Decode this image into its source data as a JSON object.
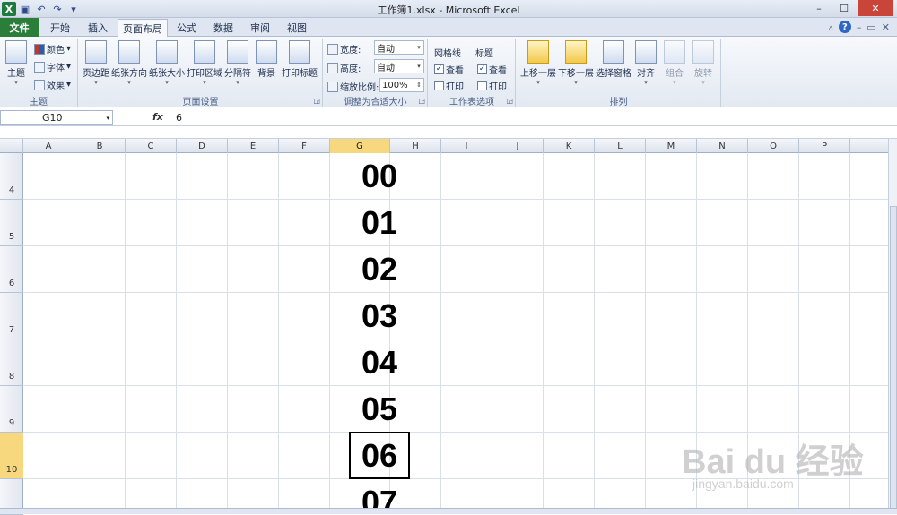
{
  "window": {
    "title": "工作簿1.xlsx - Microsoft Excel"
  },
  "tabs": [
    "文件",
    "开始",
    "插入",
    "页面布局",
    "公式",
    "数据",
    "审阅",
    "视图"
  ],
  "active_tab": "页面布局",
  "ribbon": {
    "themes": {
      "main": "主题",
      "colors": "颜色",
      "fonts": "字体",
      "effects": "效果",
      "group": "主题"
    },
    "page_setup": {
      "margins": "页边距",
      "orientation": "纸张方向",
      "size": "纸张大小",
      "print_area": "打印区域",
      "breaks": "分隔符",
      "background": "背景",
      "print_titles": "打印标题",
      "group": "页面设置"
    },
    "scale": {
      "width_label": "宽度:",
      "width_value": "自动",
      "height_label": "高度:",
      "height_value": "自动",
      "scale_label": "缩放比例:",
      "scale_value": "100%",
      "group": "调整为合适大小"
    },
    "sheet_options": {
      "gridlines": "网格线",
      "headings": "标题",
      "view": "查看",
      "print": "打印",
      "group": "工作表选项"
    },
    "arrange": {
      "bring_forward": "上移一层",
      "send_backward": "下移一层",
      "selection_pane": "选择窗格",
      "align": "对齐",
      "group_btn": "组合",
      "rotate": "旋转",
      "group": "排列"
    }
  },
  "formula_bar": {
    "name_box": "G10",
    "fx": "fx",
    "value": "6"
  },
  "columns": [
    "A",
    "B",
    "C",
    "D",
    "E",
    "F",
    "G",
    "H",
    "I",
    "J",
    "K",
    "L",
    "M",
    "N",
    "O",
    "P"
  ],
  "selected_column": "G",
  "rows": [
    "4",
    "5",
    "6",
    "7",
    "8",
    "9",
    "10"
  ],
  "selected_row": "10",
  "cells_g": [
    "00",
    "01",
    "02",
    "03",
    "04",
    "05",
    "06",
    "07"
  ],
  "watermark": {
    "brand": "Bai du 经验",
    "url": "jingyan.baidu.com"
  }
}
